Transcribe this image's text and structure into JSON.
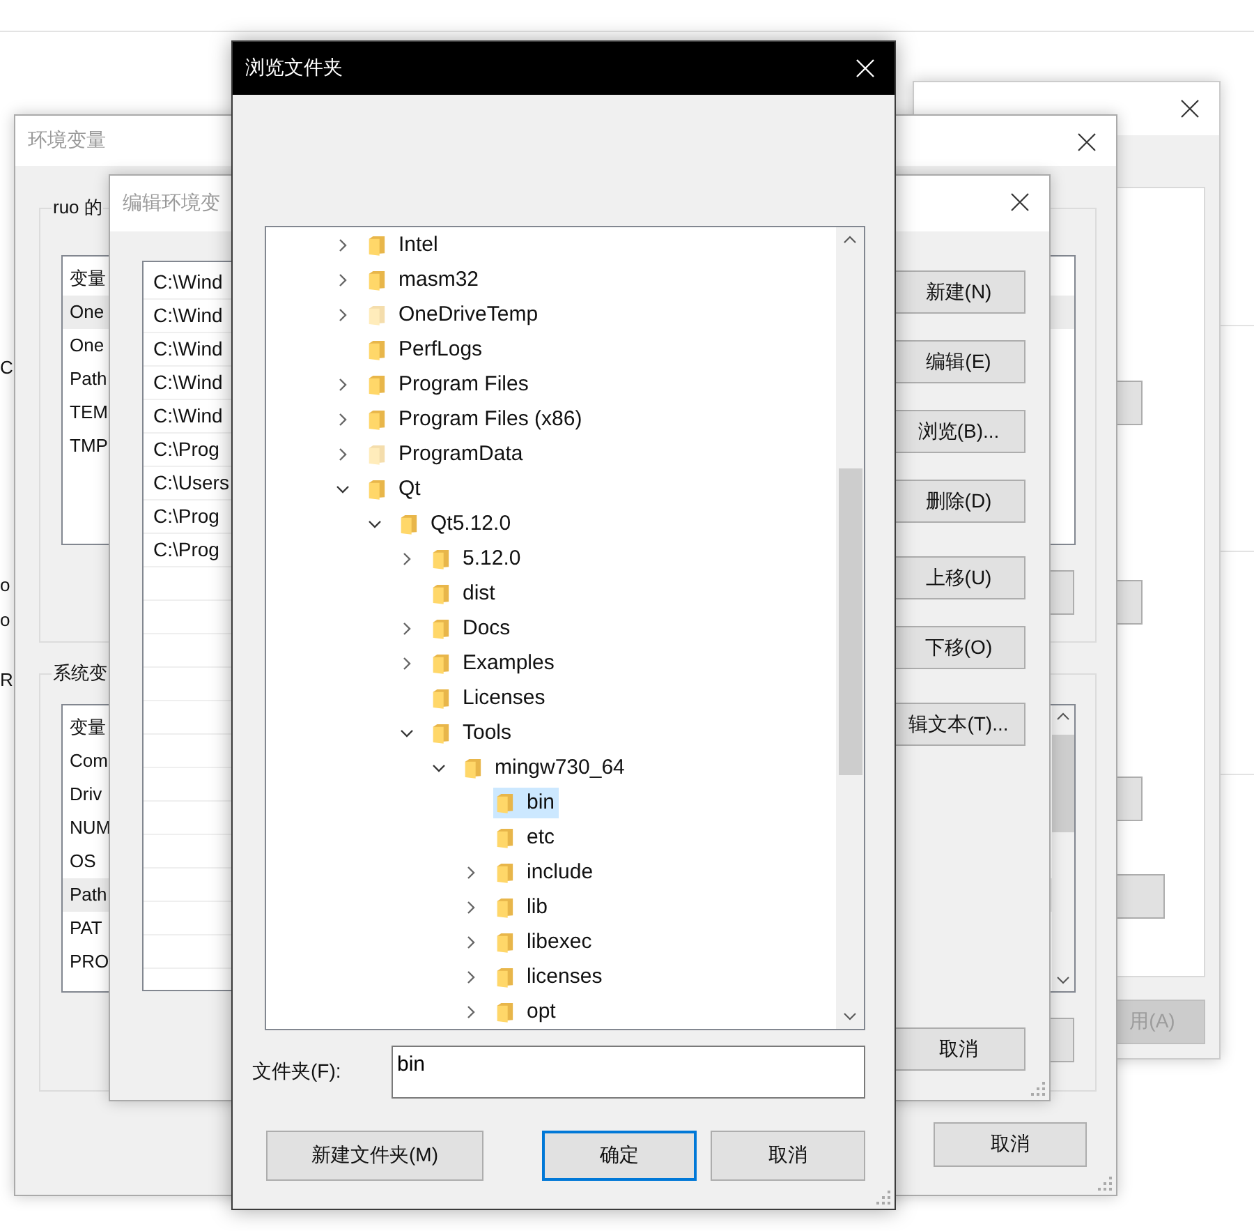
{
  "desktop_fragments": [
    {
      "text": "C"
    },
    {
      "text": "o"
    },
    {
      "text": "o"
    },
    {
      "text": "R"
    }
  ],
  "system_window": {
    "apply_button": {
      "label": "用(A)",
      "disabled": true
    }
  },
  "env_window": {
    "title": "环境变量",
    "user_group": {
      "label": "ruo 的",
      "header": "变量",
      "rows": [
        {
          "name": "One",
          "selected": true
        },
        {
          "name": "One",
          "selected": false
        },
        {
          "name": "Path",
          "selected": false
        },
        {
          "name": "TEM",
          "selected": false
        },
        {
          "name": "TMP",
          "selected": false
        }
      ]
    },
    "system_group": {
      "label": "系统变",
      "header": "变量",
      "rows": [
        {
          "name": "Com",
          "selected": false
        },
        {
          "name": "Driv",
          "selected": false
        },
        {
          "name": "NUM",
          "selected": false
        },
        {
          "name": "OS",
          "selected": false
        },
        {
          "name": "Path",
          "selected": true
        },
        {
          "name": "PAT",
          "selected": false
        },
        {
          "name": "PRO",
          "selected": false
        }
      ]
    },
    "cancel": "取消"
  },
  "edit_window": {
    "title": "编辑环境变",
    "entries": [
      "C:\\Wind",
      "C:\\Wind",
      "C:\\Wind",
      "C:\\Wind",
      "C:\\Wind",
      "C:\\Prog",
      "C:\\Users",
      "C:\\Prog",
      "C:\\Prog"
    ],
    "button_groups": [
      [
        "新建(N)",
        "编辑(E)",
        "浏览(B)...",
        "删除(D)"
      ],
      [
        "上移(U)",
        "下移(O)"
      ],
      [
        "辑文本(T)..."
      ]
    ],
    "cancel": "取消"
  },
  "browse_dialog": {
    "title": "浏览文件夹",
    "tree": [
      {
        "name": "Intel",
        "expanded": false,
        "hidden": false,
        "selected": false
      },
      {
        "name": "masm32",
        "expanded": false,
        "hidden": false,
        "selected": false
      },
      {
        "name": "OneDriveTemp",
        "expanded": false,
        "hidden": true,
        "selected": false
      },
      {
        "name": "PerfLogs",
        "hidden": false,
        "selected": false
      },
      {
        "name": "Program Files",
        "expanded": false,
        "hidden": false,
        "selected": false
      },
      {
        "name": "Program Files (x86)",
        "expanded": false,
        "hidden": false,
        "selected": false
      },
      {
        "name": "ProgramData",
        "expanded": false,
        "hidden": true,
        "selected": false
      },
      {
        "name": "Qt",
        "expanded": true,
        "hidden": false,
        "selected": false,
        "children": [
          {
            "name": "Qt5.12.0",
            "expanded": true,
            "hidden": false,
            "selected": false,
            "children": [
              {
                "name": "5.12.0",
                "expanded": false,
                "hidden": false,
                "selected": false
              },
              {
                "name": "dist",
                "hidden": false,
                "selected": false
              },
              {
                "name": "Docs",
                "expanded": false,
                "hidden": false,
                "selected": false
              },
              {
                "name": "Examples",
                "expanded": false,
                "hidden": false,
                "selected": false
              },
              {
                "name": "Licenses",
                "hidden": false,
                "selected": false
              },
              {
                "name": "Tools",
                "expanded": true,
                "hidden": false,
                "selected": false,
                "children": [
                  {
                    "name": "mingw730_64",
                    "expanded": true,
                    "hidden": false,
                    "selected": false,
                    "children": [
                      {
                        "name": "bin",
                        "hidden": false,
                        "selected": true
                      },
                      {
                        "name": "etc",
                        "hidden": false,
                        "selected": false
                      },
                      {
                        "name": "include",
                        "expanded": false,
                        "hidden": false,
                        "selected": false
                      },
                      {
                        "name": "lib",
                        "expanded": false,
                        "hidden": false,
                        "selected": false
                      },
                      {
                        "name": "libexec",
                        "expanded": false,
                        "hidden": false,
                        "selected": false
                      },
                      {
                        "name": "licenses",
                        "expanded": false,
                        "hidden": false,
                        "selected": false
                      },
                      {
                        "name": "opt",
                        "expanded": false,
                        "hidden": false,
                        "selected": false
                      }
                    ]
                  }
                ]
              }
            ]
          }
        ]
      }
    ],
    "folder_label": "文件夹(F):",
    "folder_value": "bin",
    "buttons": [
      {
        "label": "新建文件夹(M)",
        "default": false
      },
      {
        "label": "确定",
        "default": true
      },
      {
        "label": "取消",
        "default": false
      }
    ]
  }
}
